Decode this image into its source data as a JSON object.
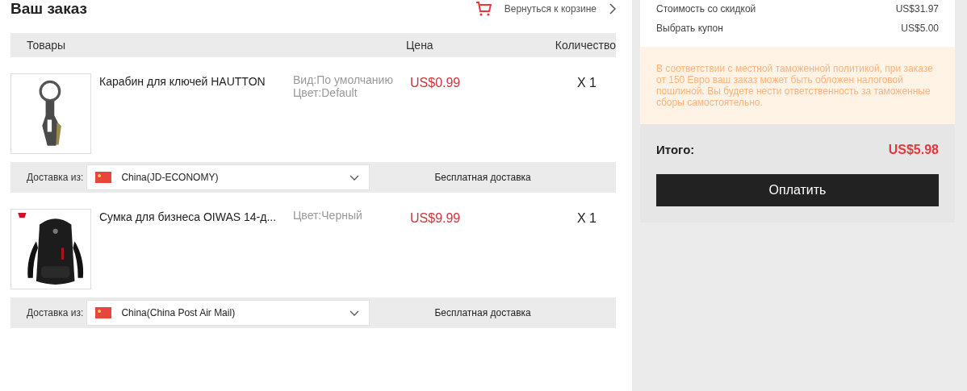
{
  "header": {
    "title": "Ваш заказ",
    "back_link": "Вернуться к корзине"
  },
  "table": {
    "columns": [
      "Товары",
      "Цена",
      "Количество"
    ],
    "rows": [
      {
        "name": "Карабин для ключей HAUTTON",
        "options": [
          "Вид:По умолчанию",
          "Цвет:Default"
        ],
        "price": "US$0.99",
        "quantity": "X 1",
        "image": {
          "kind": "picture"
        },
        "shipping_label": "Доставка из:",
        "shipping_method": "China(JD-ECONOMY)",
        "shipping_cost": "Бесплатная доставка"
      },
      {
        "name": "Сумка для бизнеса OIWAS 14-д...",
        "options": [
          "Цвет:Черный"
        ],
        "price": "US$9.99",
        "quantity": "X 1",
        "image": {
          "kind": "picture"
        },
        "shipping_label": "Доставка из:",
        "shipping_method": "China(China Post Air Mail)",
        "shipping_cost": "Бесплатная доставка"
      }
    ]
  },
  "summary": {
    "lines": [
      {
        "label": "Стоимость со скидкой",
        "value": "US$31.97"
      },
      {
        "label": "Выбрать купон",
        "value": "US$5.00"
      }
    ],
    "notice": "В соответствии с местной таможенной политикой, при заказе от 150 Евро ваш заказ может быть обложен налоговой пошлиной. Вы будете нести ответственность за таможенные сборы самостоятельно.",
    "total_label": "Итого:",
    "total_value": "US$5.98",
    "pay_button": "Оплатить"
  }
}
